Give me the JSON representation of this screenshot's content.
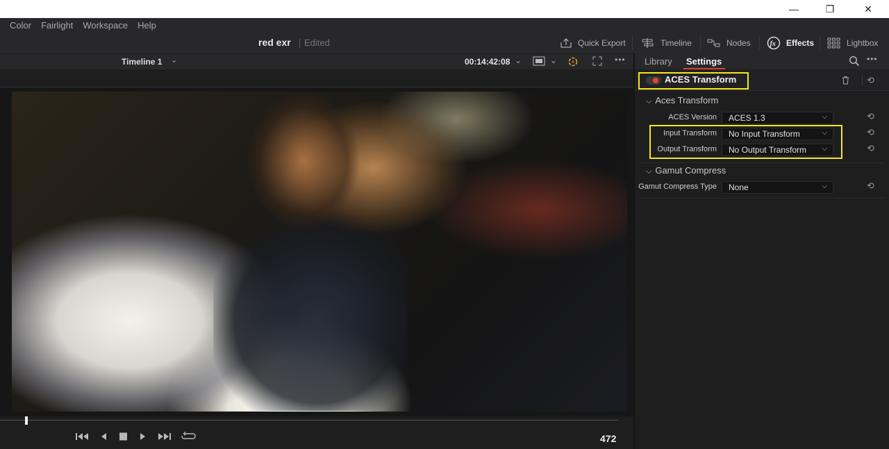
{
  "window": {
    "minimize": "—",
    "restore": "❐",
    "close": "✕"
  },
  "menu": [
    "Color",
    "Fairlight",
    "Workspace",
    "Help"
  ],
  "project": {
    "title": "red exr",
    "status": "Edited"
  },
  "toolbar": {
    "quick_export": "Quick Export",
    "timeline": "Timeline",
    "nodes": "Nodes",
    "effects": "Effects",
    "lightbox": "Lightbox"
  },
  "viewer": {
    "timeline_name": "Timeline 1",
    "timecode": "00:14:42:08",
    "frame_number": "472",
    "playhead_fraction": 0.04
  },
  "inspector": {
    "tabs": [
      "Library",
      "Settings"
    ],
    "active_tab": "Settings",
    "effect_title": "ACES Transform",
    "sections": [
      {
        "title": "Aces Transform",
        "rows": [
          {
            "label": "ACES Version",
            "value": "ACES 1.3"
          },
          {
            "label": "Input Transform",
            "value": "No Input Transform"
          },
          {
            "label": "Output Transform",
            "value": "No Output Transform"
          }
        ]
      },
      {
        "title": "Gamut Compress",
        "rows": [
          {
            "label": "Gamut Compress Type",
            "value": "None"
          }
        ]
      }
    ]
  },
  "colors": {
    "accent": "#e0402a",
    "highlight": "#f5e71e",
    "panel": "#1e1e1f"
  }
}
